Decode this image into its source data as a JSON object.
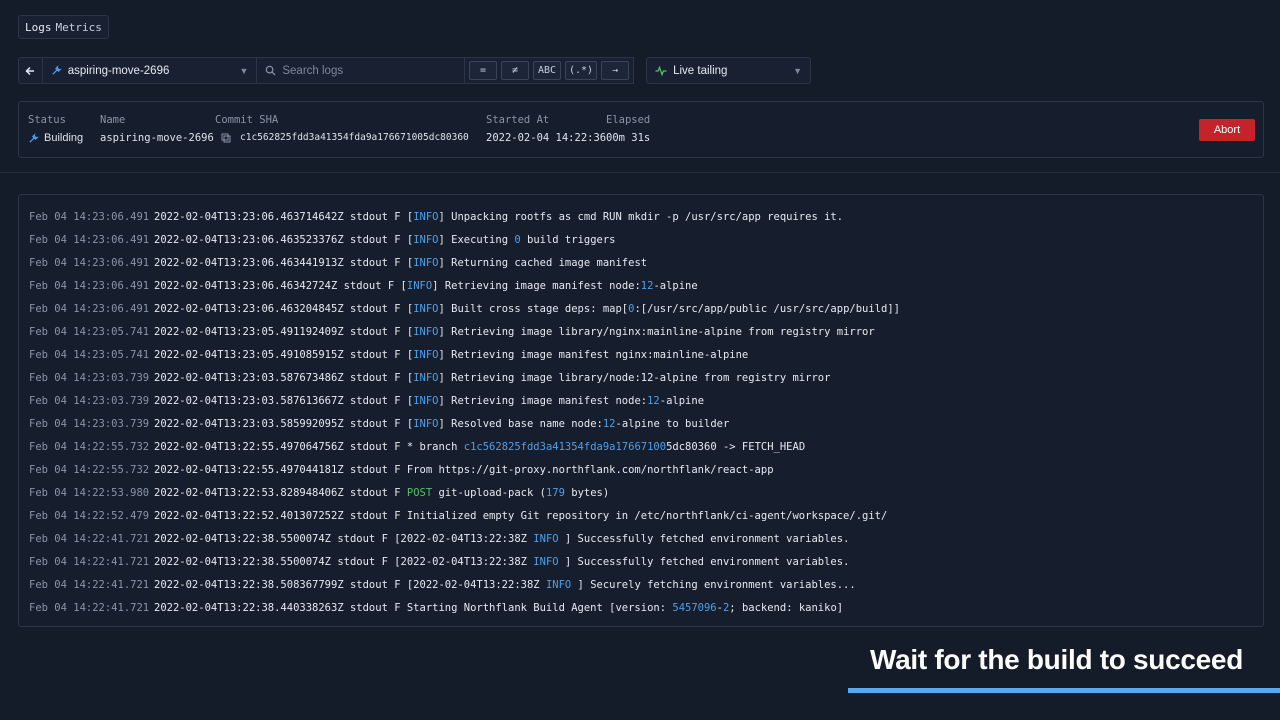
{
  "tabs": [
    "Logs",
    "Metrics"
  ],
  "toolbar": {
    "pipeline_name": "aspiring-move-2696",
    "search_placeholder": "Search logs",
    "toggles": [
      "=",
      "≠",
      "ABC",
      "(.*)",
      "→"
    ],
    "live_label": "Live tailing"
  },
  "info": {
    "status_label": "Status",
    "status_value": "Building",
    "name_label": "Name",
    "name_value": "aspiring-move-2696",
    "sha_label": "Commit SHA",
    "sha_value": "c1c562825fdd3a41354fda9a176671005dc80360",
    "started_label": "Started At",
    "started_value": "2022-02-04 14:22:36",
    "elapsed_label": "Elapsed",
    "elapsed_value": "00m 31s",
    "abort_label": "Abort"
  },
  "logs": [
    {
      "time": "Feb 04 14:23:06.491",
      "parts": [
        [
          "2022-02-04T13:23:06.463714642Z stdout F [",
          ""
        ],
        [
          "INFO",
          "blue"
        ],
        [
          "] Unpacking rootfs as cmd RUN mkdir -p /usr/src/app requires it.",
          ""
        ]
      ]
    },
    {
      "time": "Feb 04 14:23:06.491",
      "parts": [
        [
          "2022-02-04T13:23:06.463523376Z stdout F [",
          ""
        ],
        [
          "INFO",
          "blue"
        ],
        [
          "] Executing ",
          ""
        ],
        [
          "0",
          "blue"
        ],
        [
          " build triggers",
          ""
        ]
      ]
    },
    {
      "time": "Feb 04 14:23:06.491",
      "parts": [
        [
          "2022-02-04T13:23:06.463441913Z stdout F [",
          ""
        ],
        [
          "INFO",
          "blue"
        ],
        [
          "] Returning cached image manifest",
          ""
        ]
      ]
    },
    {
      "time": "Feb 04 14:23:06.491",
      "parts": [
        [
          "2022-02-04T13:23:06.46342724Z stdout F [",
          ""
        ],
        [
          "INFO",
          "blue"
        ],
        [
          "] Retrieving image manifest node:",
          ""
        ],
        [
          "12",
          "blue"
        ],
        [
          "-alpine",
          ""
        ]
      ]
    },
    {
      "time": "Feb 04 14:23:06.491",
      "parts": [
        [
          "2022-02-04T13:23:06.463204845Z stdout F [",
          ""
        ],
        [
          "INFO",
          "blue"
        ],
        [
          "] Built cross stage deps: map[",
          ""
        ],
        [
          "0",
          "blue"
        ],
        [
          ":[/usr/src/app/public /usr/src/app/build]]",
          ""
        ]
      ]
    },
    {
      "time": "Feb 04 14:23:05.741",
      "parts": [
        [
          "2022-02-04T13:23:05.491192409Z stdout F [",
          ""
        ],
        [
          "INFO",
          "blue"
        ],
        [
          "] Retrieving image library/nginx:mainline-alpine from registry mirror",
          ""
        ]
      ]
    },
    {
      "time": "Feb 04 14:23:05.741",
      "parts": [
        [
          "2022-02-04T13:23:05.491085915Z stdout F [",
          ""
        ],
        [
          "INFO",
          "blue"
        ],
        [
          "] Retrieving image manifest nginx:mainline-alpine",
          ""
        ]
      ]
    },
    {
      "time": "Feb 04 14:23:03.739",
      "parts": [
        [
          "2022-02-04T13:23:03.587673486Z stdout F [",
          ""
        ],
        [
          "INFO",
          "blue"
        ],
        [
          "] Retrieving image library/node:12-alpine from registry mirror",
          ""
        ]
      ]
    },
    {
      "time": "Feb 04 14:23:03.739",
      "parts": [
        [
          "2022-02-04T13:23:03.587613667Z stdout F [",
          ""
        ],
        [
          "INFO",
          "blue"
        ],
        [
          "] Retrieving image manifest node:",
          ""
        ],
        [
          "12",
          "blue"
        ],
        [
          "-alpine",
          ""
        ]
      ]
    },
    {
      "time": "Feb 04 14:23:03.739",
      "parts": [
        [
          "2022-02-04T13:23:03.585992095Z stdout F [",
          ""
        ],
        [
          "INFO",
          "blue"
        ],
        [
          "] Resolved base name node:",
          ""
        ],
        [
          "12",
          "blue"
        ],
        [
          "-alpine to builder",
          ""
        ]
      ]
    },
    {
      "time": "Feb 04 14:22:55.732",
      "parts": [
        [
          "2022-02-04T13:22:55.497064756Z stdout F * branch ",
          ""
        ],
        [
          "c1c562825fdd3a41354fda9a17667100",
          "blue"
        ],
        [
          "5dc80360 -> FETCH_HEAD",
          ""
        ]
      ]
    },
    {
      "time": "Feb 04 14:22:55.732",
      "parts": [
        [
          "2022-02-04T13:22:55.497044181Z stdout F From https://git-proxy.northflank.com/northflank/react-app",
          ""
        ]
      ]
    },
    {
      "time": "Feb 04 14:22:53.980",
      "parts": [
        [
          "2022-02-04T13:22:53.828948406Z stdout F ",
          ""
        ],
        [
          "POST",
          "green"
        ],
        [
          " git-upload-pack (",
          ""
        ],
        [
          "179",
          "blue"
        ],
        [
          " bytes)",
          ""
        ]
      ]
    },
    {
      "time": "Feb 04 14:22:52.479",
      "parts": [
        [
          "2022-02-04T13:22:52.401307252Z stdout F Initialized empty Git repository in /etc/northflank/ci-agent/workspace/.git/",
          ""
        ]
      ]
    },
    {
      "time": "Feb 04 14:22:41.721",
      "parts": [
        [
          "2022-02-04T13:22:38.5500074Z stdout F [2022-02-04T13:22:38Z ",
          ""
        ],
        [
          "INFO",
          "blue"
        ],
        [
          " ] Successfully fetched environment variables.",
          ""
        ]
      ]
    },
    {
      "time": "Feb 04 14:22:41.721",
      "parts": [
        [
          "2022-02-04T13:22:38.5500074Z stdout F [2022-02-04T13:22:38Z ",
          ""
        ],
        [
          "INFO",
          "blue"
        ],
        [
          " ] Successfully fetched environment variables.",
          ""
        ]
      ]
    },
    {
      "time": "Feb 04 14:22:41.721",
      "parts": [
        [
          "2022-02-04T13:22:38.508367799Z stdout F [2022-02-04T13:22:38Z ",
          ""
        ],
        [
          "INFO",
          "blue"
        ],
        [
          " ] Securely fetching environment variables...",
          ""
        ]
      ]
    },
    {
      "time": "Feb 04 14:22:41.721",
      "parts": [
        [
          "2022-02-04T13:22:38.440338263Z stdout F Starting Northflank Build Agent [version: ",
          ""
        ],
        [
          "5457096",
          "blue"
        ],
        [
          "-",
          ""
        ],
        [
          "2",
          "blue"
        ],
        [
          "; backend: kaniko]",
          ""
        ]
      ]
    }
  ],
  "caption": "Wait for the build to succeed",
  "colors": {
    "accent": "#4ea0e8",
    "abort": "#c4232b",
    "caption_bar": "#5aa9f0"
  }
}
